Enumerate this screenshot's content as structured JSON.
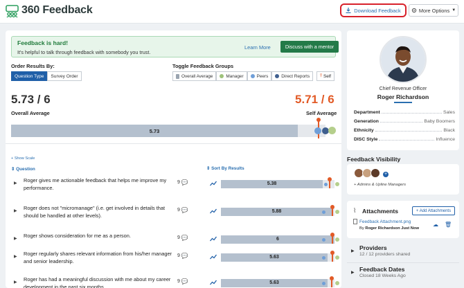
{
  "header": {
    "app_title": "360 Feedback",
    "download_label": "Download Feedback",
    "more_label": "More Options"
  },
  "alert": {
    "title": "Feedback is hard!",
    "text": "It's helpful to talk through feedback with somebody you trust.",
    "learn_more": "Learn More",
    "mentor_button": "Discuss with a mentor"
  },
  "order": {
    "label": "Order Results By:",
    "options": [
      "Question Type",
      "Survey Order"
    ],
    "selected": "Question Type"
  },
  "toggle_groups": {
    "label": "Toggle Feedback Groups",
    "items": [
      {
        "label": "Overall Average",
        "color": "#9aa4b0"
      },
      {
        "label": "Manager",
        "color": "#9ec27a"
      },
      {
        "label": "Peers",
        "color": "#6f9fd8"
      },
      {
        "label": "Direct Reports",
        "color": "#3f5f8f"
      }
    ],
    "self_label": "Self",
    "self_color": "#e25a26"
  },
  "summary": {
    "overall_score": "5.73 / 6",
    "self_score": "5.71 / 6",
    "overall_label": "Overall Average",
    "self_label": "Self Average",
    "bar_value": "5.73",
    "scale_max": 6,
    "overall_value": 5.73,
    "self_value": 5.71
  },
  "list": {
    "show_scale": "+ Show Scale",
    "question_col": "Question",
    "sort_col": "Sort By Results",
    "rows": [
      {
        "text": "Roger gives me actionable feedback that helps me improve my performance.",
        "count": "9",
        "value": "5.38",
        "score": 5.38,
        "self": 5.7
      },
      {
        "text": "Roger does not \"micromanage\" (i.e. get involved in details that should be handled at other levels).",
        "count": "9",
        "value": "5.88",
        "score": 5.88,
        "self": 5.9
      },
      {
        "text": "Roger shows consideration for me as a person.",
        "count": "9",
        "value": "6",
        "score": 6,
        "self": 6
      },
      {
        "text": "Roger regularly shares relevant information from his/her manager and senior leadership.",
        "count": "9",
        "value": "5.63",
        "score": 5.63,
        "self": 5.9
      },
      {
        "text": "Roger has had a meaningful discussion with me about my career development in the past six months.",
        "count": "9",
        "value": "5.63",
        "score": 5.63,
        "self": 5.8
      }
    ]
  },
  "profile": {
    "job_title": "Chief Revenue Officer",
    "name": "Roger Richardson",
    "attributes": [
      {
        "key": "Department",
        "value": "Sales"
      },
      {
        "key": "Generation",
        "value": "Baby Boomers"
      },
      {
        "key": "Ethnicity",
        "value": "Black"
      },
      {
        "key": "DISC Style",
        "value": "Influence"
      }
    ]
  },
  "visibility": {
    "title": "Feedback Visibility",
    "text": "+ Admins & Upline Managers"
  },
  "attachments": {
    "title": "Attachments",
    "add_label": "+ Add Attachments",
    "file_name": "Feedback Attachment.png",
    "by_prefix": "By",
    "by_name": "Roger Richardson",
    "by_time": "Just Now"
  },
  "providers": {
    "title": "Providers",
    "subtitle": "12 / 12 providers shared"
  },
  "dates": {
    "title": "Feedback Dates",
    "subtitle": "Closed 18 Weeks Ago"
  }
}
